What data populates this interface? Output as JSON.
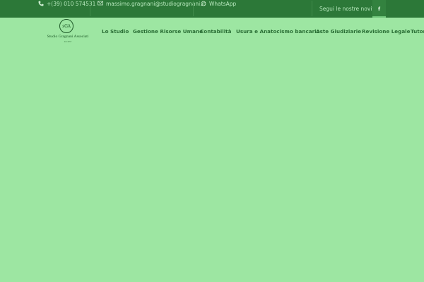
{
  "topbar": {
    "phone": "+(39) 010 574531",
    "email": "massimo.gragnani@studiogragnani.it",
    "whatsapp": "WhatsApp",
    "follow": "Segui le nostre novità:",
    "facebook": "f"
  },
  "logo": {
    "monogram": "sGA",
    "name": "Studio Gragnani Associati",
    "sub": "dal 1957"
  },
  "nav": {
    "items": [
      "Lo Studio",
      "Gestione Risorse Umane",
      "Contabilità",
      "Usura e Anatocismo bancario",
      "Aste Giudiziarie",
      "Revisione Legale",
      "Tutori"
    ]
  },
  "colors": {
    "topbar_bg": "#2c7838",
    "page_bg": "#9de6a2",
    "nav_text": "#2a6e35",
    "topbar_text": "#b7e8bd"
  }
}
